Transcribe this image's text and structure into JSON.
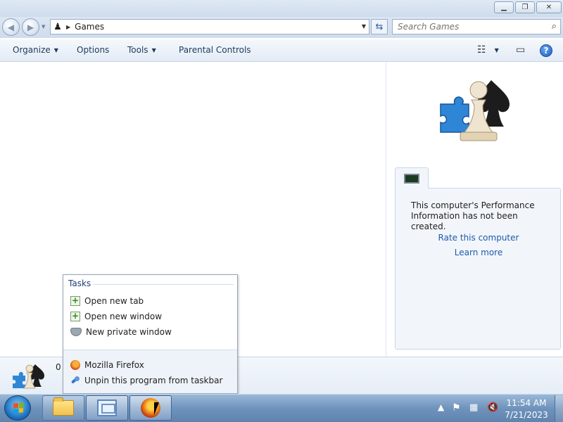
{
  "window": {
    "minimize_icon": "minimize-icon",
    "maximize_icon": "restore-icon",
    "close_icon": "close-icon"
  },
  "address": {
    "location": "Games",
    "search_placeholder": "Search Games"
  },
  "toolbar": {
    "organize": "Organize",
    "options": "Options",
    "tools": "Tools",
    "parental_controls": "Parental Controls"
  },
  "performance": {
    "message": "This computer's Performance Information has not been created.",
    "rate_link": "Rate this computer",
    "learn_link": "Learn more"
  },
  "details": {
    "count": "0"
  },
  "jumplist": {
    "tasks_header": "Tasks",
    "tasks": [
      {
        "label": "Open new tab",
        "icon": "plus-icon"
      },
      {
        "label": "Open new window",
        "icon": "plus-icon"
      },
      {
        "label": "New private window",
        "icon": "private-mask-icon"
      }
    ],
    "bottom": [
      {
        "label": "Mozilla Firefox",
        "icon": "firefox-icon"
      },
      {
        "label": "Unpin this program from taskbar",
        "icon": "unpin-icon"
      }
    ]
  },
  "taskbar": {
    "time": "11:54 AM",
    "date": "7/21/2023",
    "tray_icons": [
      "show-hidden-icons",
      "action-center-flag-icon",
      "network-icon",
      "volume-muted-icon"
    ]
  }
}
